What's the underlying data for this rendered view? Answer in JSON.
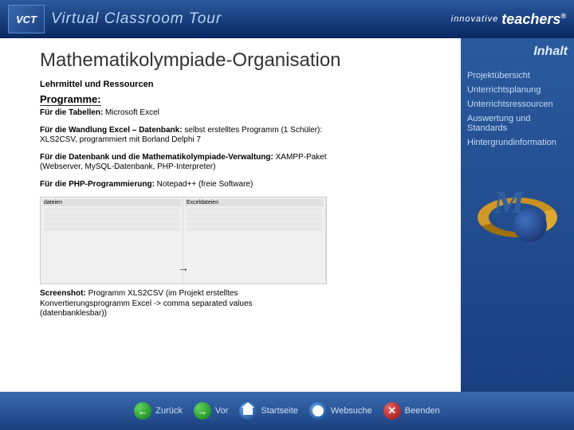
{
  "header": {
    "badge": "VCT",
    "title": "Virtual Classroom Tour",
    "innovative": "innovative",
    "teachers": "teachers",
    "reg": "®"
  },
  "main": {
    "title": "Mathematikolympiade-Organisation",
    "section": "Lehrmittel und Ressourcen",
    "subhead": "Programme:",
    "p1_label": "Für die Tabellen:",
    "p1_text": " Microsoft Excel",
    "p2_label": "Für die Wandlung Excel – Datenbank:",
    "p2_text": " selbst erstelltes Programm (1 Schüler): XLS2CSV, programmiert mit Borland Delphi 7",
    "p3_label": "Für die Datenbank und die Mathematikolympiade-Verwaltung:",
    "p3_text": " XAMPP-Paket (Webserver, MySQL-Datenbank, PHP-Interpreter)",
    "p4_label": "Für die PHP-Programmierung:",
    "p4_text": " Notepad++ (freie Software)",
    "sa_left": "dateien",
    "sa_right": "Exceldateien",
    "caption_label": "Screenshot:",
    "caption_text": " Programm XLS2CSV (im Projekt erstelltes Konvertierungsprogramm Excel -> comma separated values (datenbanklesbar))"
  },
  "sidebar": {
    "title": "Inhalt",
    "items": [
      "Projektübersicht",
      "Unterrichtsplanung",
      "Unterrichtsressourcen",
      "Auswertung und Standards",
      "Hintergrundinformation"
    ]
  },
  "footer": {
    "back": "Zurück",
    "fwd": "Vor",
    "home": "Startseite",
    "web": "Websuche",
    "exit": "Beenden"
  }
}
